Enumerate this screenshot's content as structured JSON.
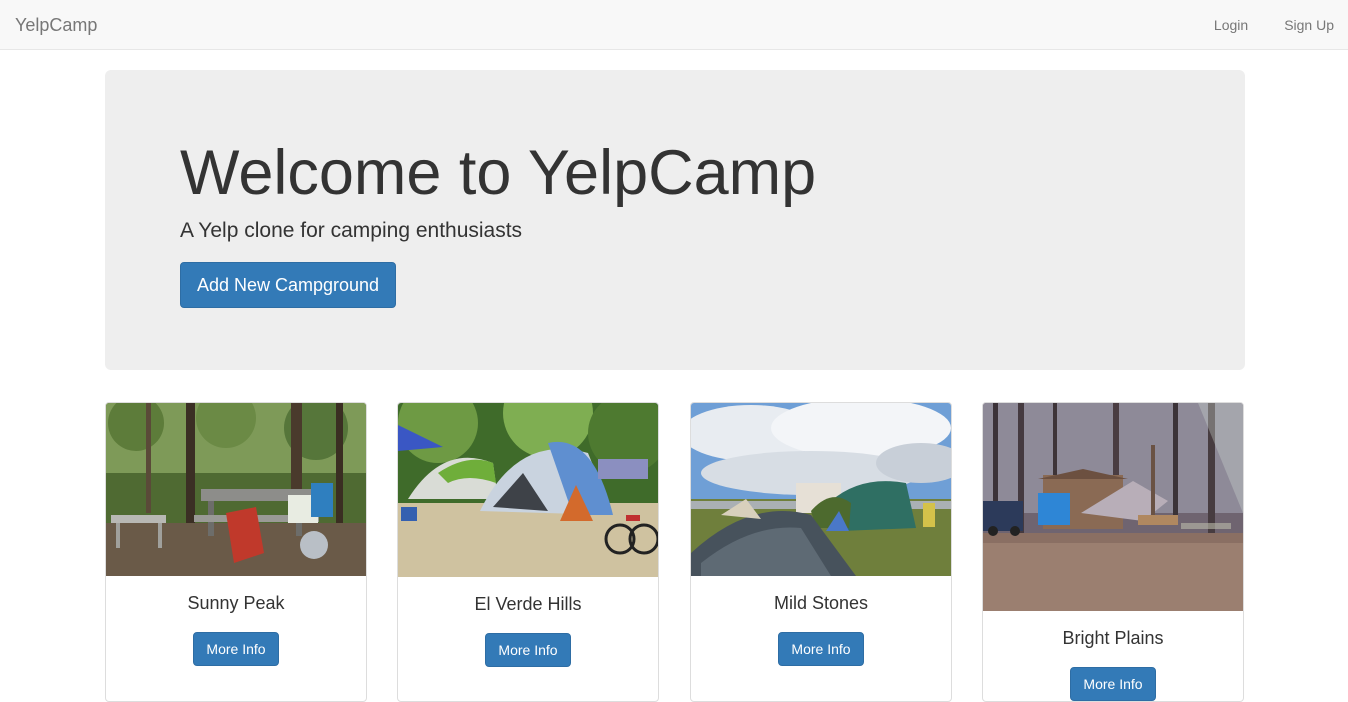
{
  "navbar": {
    "brand": "YelpCamp",
    "links": [
      "Login",
      "Sign Up"
    ]
  },
  "jumbotron": {
    "title": "Welcome to YelpCamp",
    "subtitle": "A Yelp clone for camping enthusiasts",
    "button_label": "Add New Campground"
  },
  "campgrounds": [
    {
      "name": "Sunny Peak",
      "button_label": "More Info"
    },
    {
      "name": "El Verde Hills",
      "button_label": "More Info"
    },
    {
      "name": "Mild Stones",
      "button_label": "More Info"
    },
    {
      "name": "Bright Plains",
      "button_label": "More Info"
    }
  ],
  "colors": {
    "primary": "#337ab7",
    "navbar_bg": "#f8f8f8",
    "jumbotron_bg": "#eeeeee"
  }
}
